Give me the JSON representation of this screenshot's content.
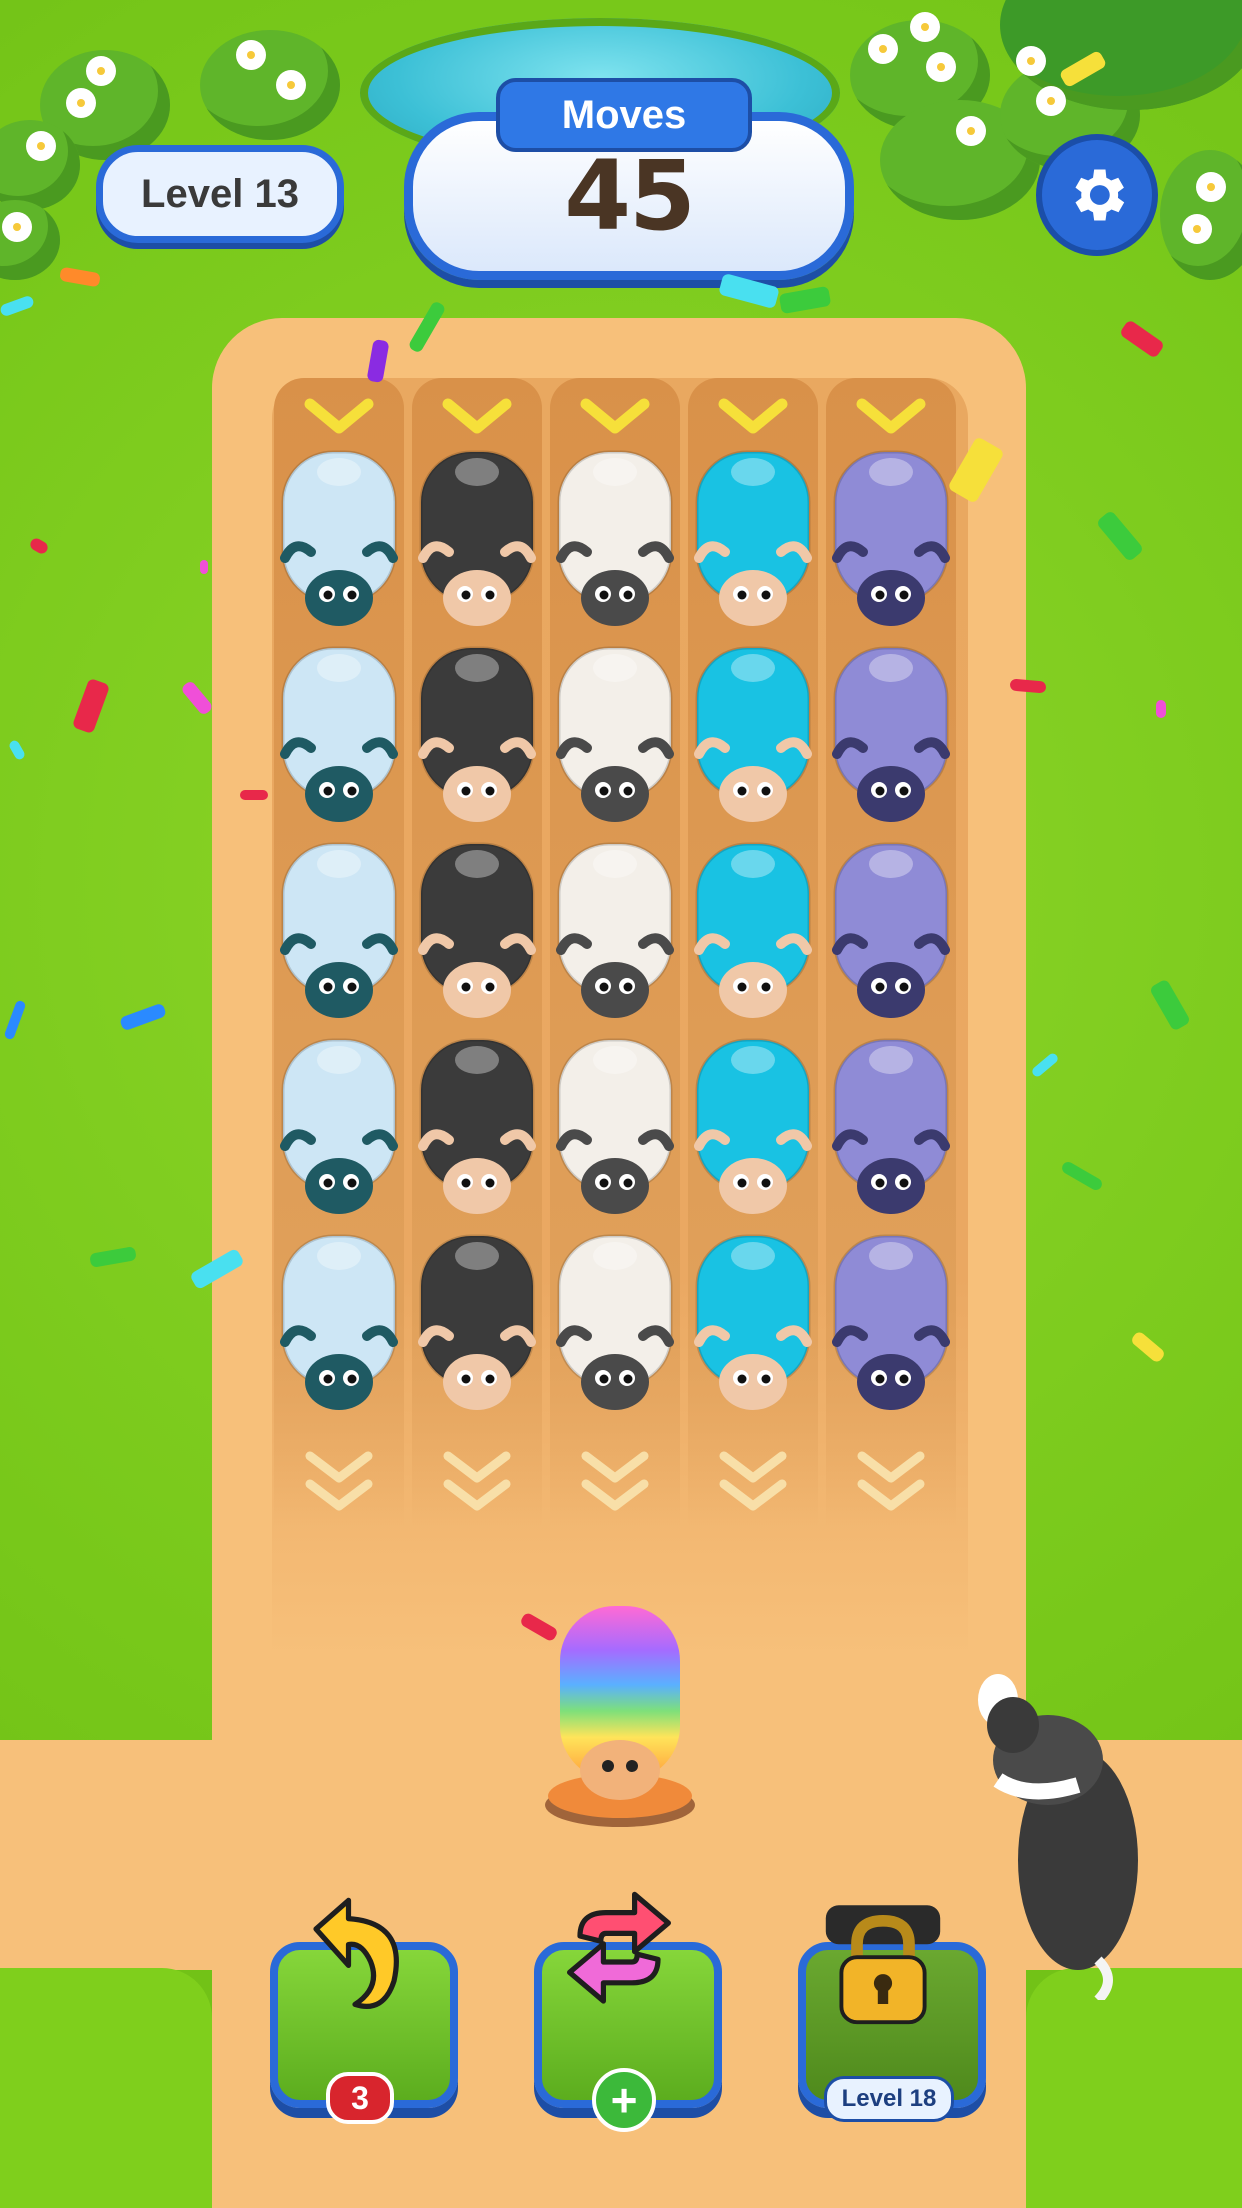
{
  "hud": {
    "level_label": "Level 13",
    "moves_label": "Moves",
    "moves_value": "45"
  },
  "board": {
    "columns": [
      {
        "color": "#cde6f5",
        "face": "#1f5a63"
      },
      {
        "color": "#3b3b3b",
        "face": "#f0c8a8"
      },
      {
        "color": "#f3efe9",
        "face": "#4a4a4a"
      },
      {
        "color": "#19c2e3",
        "face": "#f0c8a8"
      },
      {
        "color": "#8f8bd6",
        "face": "#3b3a6e"
      }
    ],
    "rows": 5,
    "current_piece": "rainbow-sheep"
  },
  "tools": {
    "undo": {
      "icon": "undo-arrow-icon",
      "count": "3"
    },
    "shuffle": {
      "icon": "shuffle-icon",
      "add_label": "+"
    },
    "locked": {
      "icon": "padlock-icon",
      "unlock_label": "Level 18"
    }
  },
  "colors": {
    "accent_blue": "#2a6ad8",
    "grass": "#7fcf1c",
    "path": "#f7c07a"
  }
}
